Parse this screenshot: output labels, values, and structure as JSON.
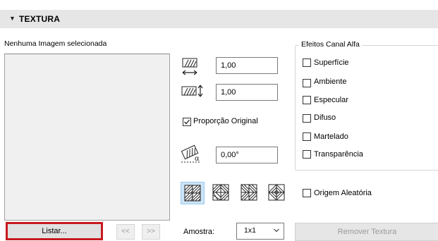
{
  "section": {
    "title": "TEXTURA"
  },
  "image": {
    "status_label": "Nenhuma Imagem selecionada"
  },
  "buttons": {
    "listar": "Listar...",
    "prev": "<<",
    "next": ">>",
    "remove_texture": "Remover Textura"
  },
  "size": {
    "width_value": "1,00",
    "height_value": "1,00",
    "keep_proportion_label": "Proporção Original",
    "keep_proportion_checked": true,
    "rotation_value": "0,00°"
  },
  "alpha_effects": {
    "title": "Efeitos Canal Alfa",
    "items": [
      {
        "label": "Superfície",
        "checked": false
      },
      {
        "label": "Ambiente",
        "checked": false
      },
      {
        "label": "Especular",
        "checked": false
      },
      {
        "label": "Difuso",
        "checked": false
      },
      {
        "label": "Martelado",
        "checked": false
      },
      {
        "label": "Transparência",
        "checked": false
      }
    ]
  },
  "mirror_patterns": [
    "pattern-normal-icon",
    "pattern-mirror-x-icon",
    "pattern-mirror-y-icon",
    "pattern-mirror-xy-icon"
  ],
  "random_origin": {
    "label": "Origem Aleatória",
    "checked": false
  },
  "sample": {
    "label": "Amostra:",
    "value": "1x1"
  },
  "colors": {
    "accent_highlight": "#c8191e",
    "selected_pattern_bg": "#cce4f7"
  }
}
